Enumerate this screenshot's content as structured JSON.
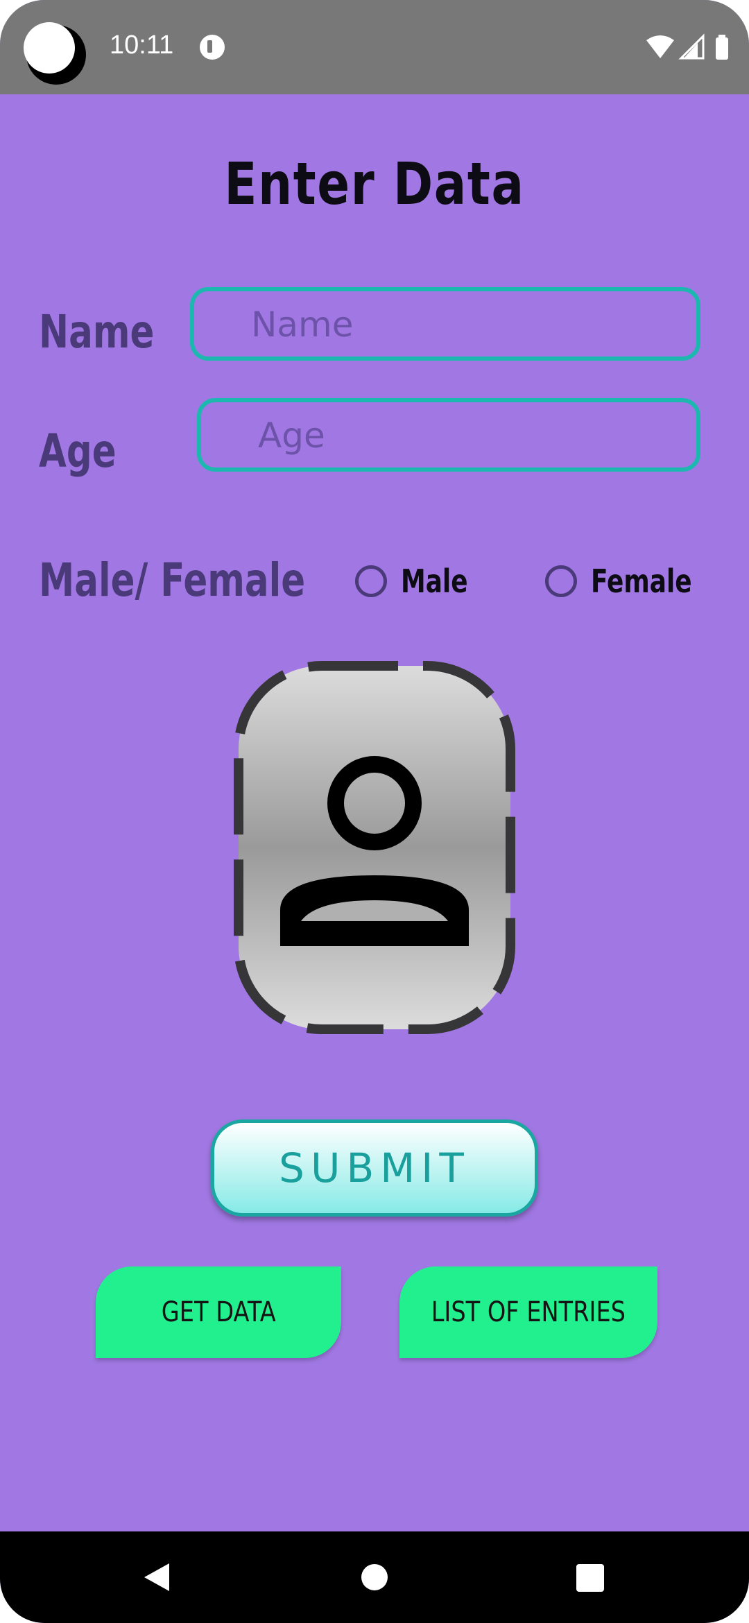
{
  "status_bar": {
    "time": "10:11",
    "icons": [
      "camera-cutout",
      "notification-icon",
      "wifi-icon",
      "signal-icon",
      "battery-icon"
    ]
  },
  "form": {
    "title": "Enter  Data",
    "name_label": "Name",
    "name_placeholder": "Name",
    "age_label": "Age",
    "age_placeholder": "Age",
    "gender_label": "Male/ Female",
    "gender_options": [
      "Male",
      "Female"
    ],
    "photo_icon": "person-placeholder-icon"
  },
  "buttons": {
    "submit": "SUBMIT",
    "get_data": "GET DATA",
    "list_entries": "LIST OF ENTRIES"
  },
  "colors": {
    "background": "#a178e3",
    "field_border": "#1cb8b0",
    "accent_green": "#22f08f",
    "label_purple": "#4a3a7a"
  },
  "navigation": {
    "icons": [
      "back-icon",
      "home-icon",
      "recents-icon"
    ]
  }
}
